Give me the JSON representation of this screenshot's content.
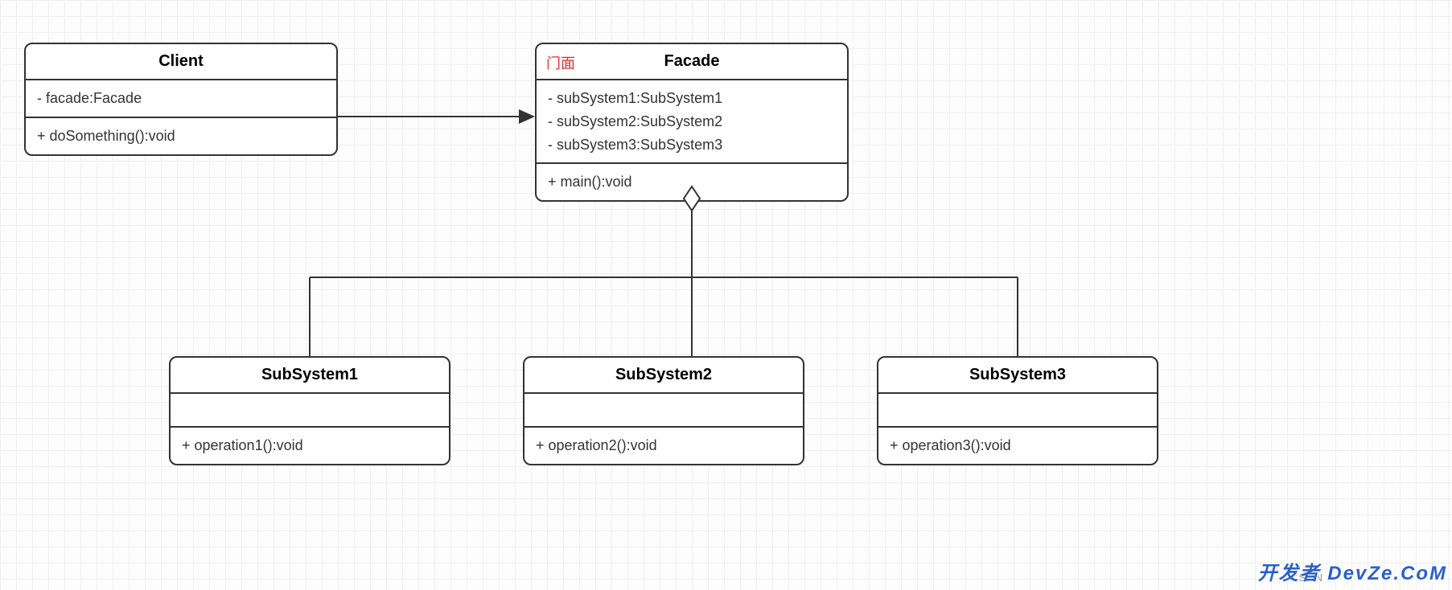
{
  "diagram": {
    "pattern": "Facade",
    "classes": {
      "client": {
        "name": "Client",
        "attributes": [
          "- facade:Facade"
        ],
        "operations": [
          "+ doSomething():void"
        ]
      },
      "facade": {
        "stereotype": "门面",
        "name": "Facade",
        "attributes": [
          "- subSystem1:SubSystem1",
          "- subSystem2:SubSystem2",
          "- subSystem3:SubSystem3"
        ],
        "operations": [
          "+ main():void"
        ]
      },
      "sub1": {
        "name": "SubSystem1",
        "attributes": [],
        "operations": [
          "+ operation1():void"
        ]
      },
      "sub2": {
        "name": "SubSystem2",
        "attributes": [],
        "operations": [
          "+ operation2():void"
        ]
      },
      "sub3": {
        "name": "SubSystem3",
        "attributes": [],
        "operations": [
          "+ operation3():void"
        ]
      }
    },
    "relations": [
      {
        "from": "client",
        "to": "facade",
        "type": "association-arrow"
      },
      {
        "from": "facade",
        "to": "sub1",
        "type": "aggregation"
      },
      {
        "from": "facade",
        "to": "sub2",
        "type": "aggregation"
      },
      {
        "from": "facade",
        "to": "sub3",
        "type": "aggregation"
      }
    ]
  },
  "watermark": {
    "csdn": "CSDN",
    "right": "开发者 DevZe.CoM"
  }
}
